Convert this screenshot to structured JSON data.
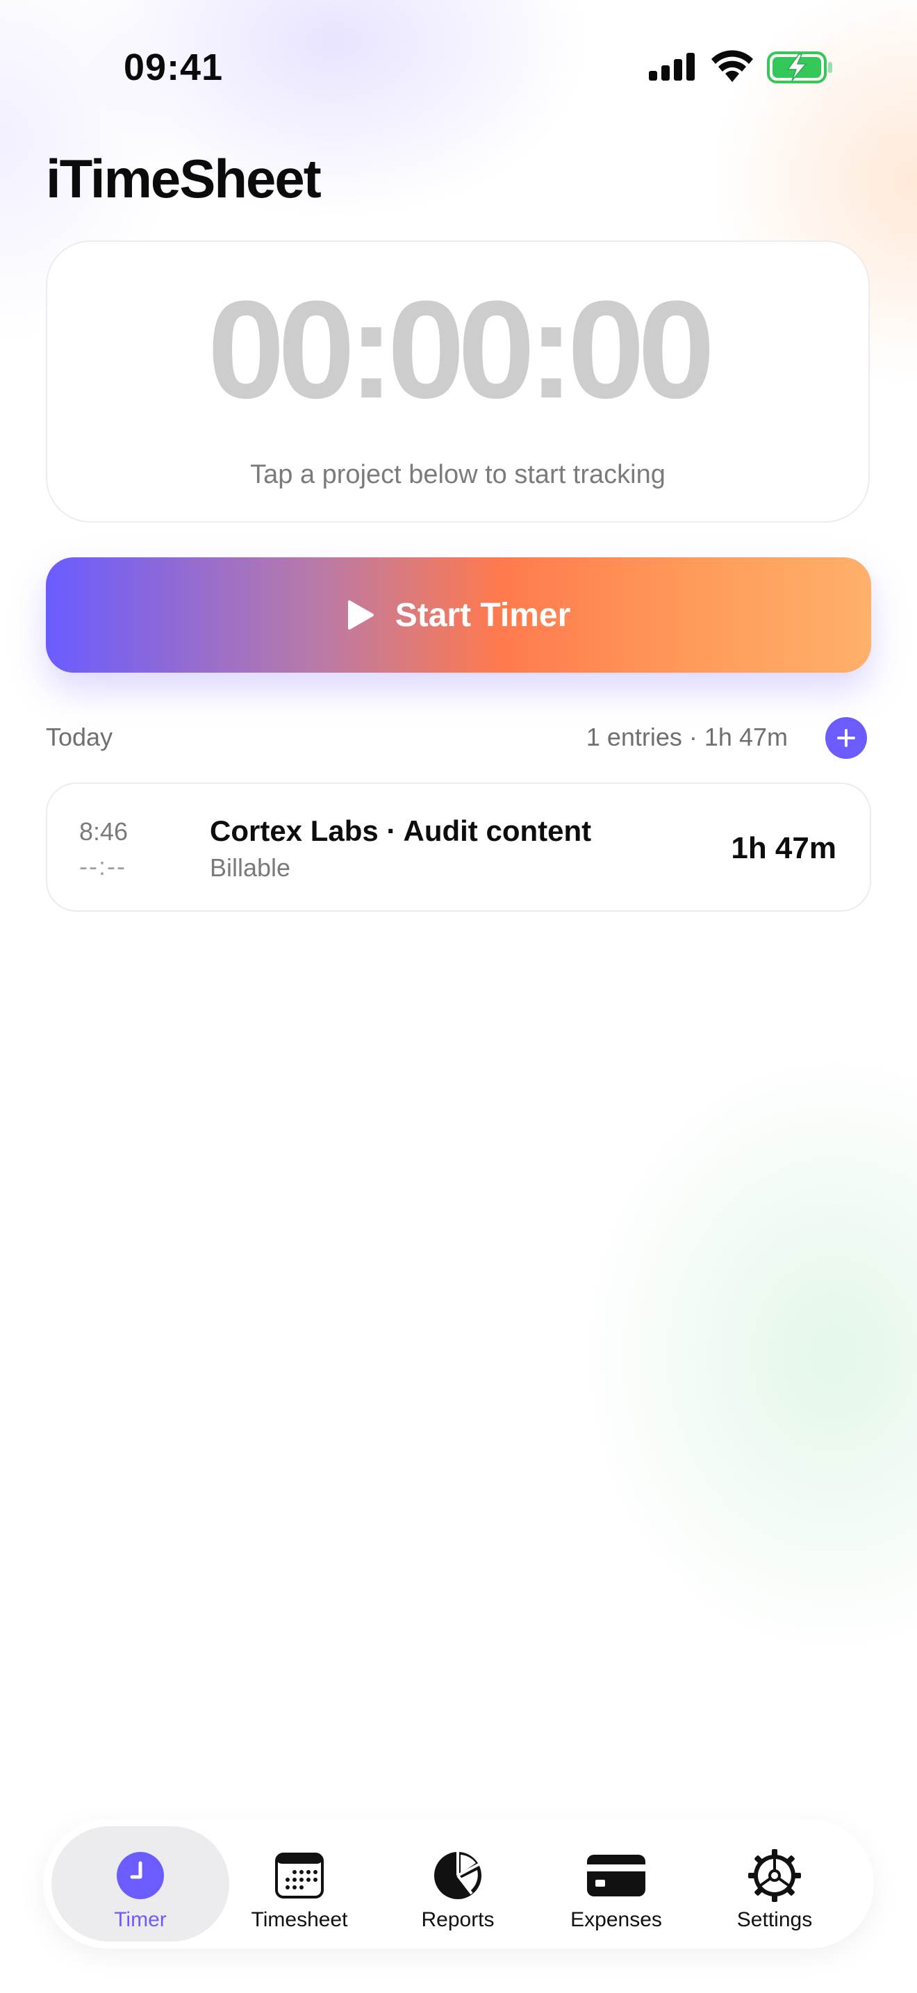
{
  "status_bar": {
    "time": "09:41"
  },
  "app": {
    "title": "iTimeSheet"
  },
  "timer": {
    "display": "00:00:00",
    "hint": "Tap a project below to start tracking"
  },
  "start_button": {
    "label": "Start Timer"
  },
  "today": {
    "label": "Today",
    "summary": "1 entries · 1h 47m",
    "entries": [
      {
        "start": "8:46",
        "end": "--:--",
        "title": "Cortex Labs · Audit content",
        "tag": "Billable",
        "duration": "1h 47m"
      }
    ]
  },
  "tabs": [
    {
      "label": "Timer",
      "icon": "clock-icon",
      "active": true
    },
    {
      "label": "Timesheet",
      "icon": "calendar-icon",
      "active": false
    },
    {
      "label": "Reports",
      "icon": "pie-chart-icon",
      "active": false
    },
    {
      "label": "Expenses",
      "icon": "credit-card-icon",
      "active": false
    },
    {
      "label": "Settings",
      "icon": "gear-icon",
      "active": false
    }
  ],
  "colors": {
    "accent": "#6b5cff",
    "gradient_start": "#6a5cff",
    "gradient_mid": "#ff7a4d",
    "gradient_end": "#ffb06a",
    "battery_green": "#34c759"
  }
}
